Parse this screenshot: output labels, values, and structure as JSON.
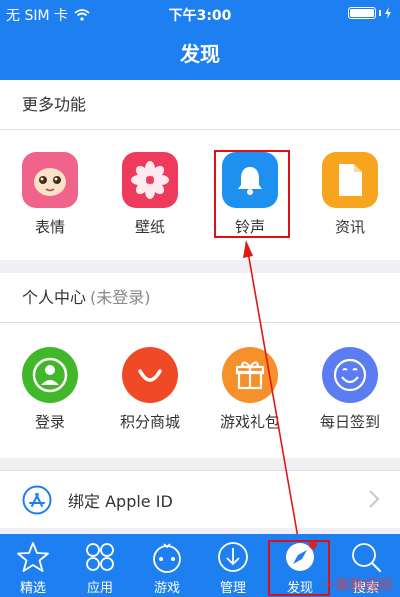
{
  "status_bar": {
    "carrier": "无 SIM 卡",
    "time": "下午3:00"
  },
  "nav": {
    "title": "发现"
  },
  "more_features": {
    "title": "更多功能",
    "items": [
      {
        "label": "表情",
        "icon": "emoji-face-icon",
        "color": "#f0648c"
      },
      {
        "label": "壁纸",
        "icon": "flower-icon",
        "color": "#ee3a5d"
      },
      {
        "label": "铃声",
        "icon": "bell-icon",
        "color": "#1e90f0"
      },
      {
        "label": "资讯",
        "icon": "document-icon",
        "color": "#f7a51e"
      }
    ]
  },
  "personal_center": {
    "title": "个人中心",
    "subtitle": "(未登录)",
    "items": [
      {
        "label": "登录",
        "icon": "user-icon",
        "color": "#42b72a"
      },
      {
        "label": "积分商城",
        "icon": "smile-arc-icon",
        "color": "#ef4a25"
      },
      {
        "label": "游戏礼包",
        "icon": "gift-icon",
        "color": "#f5902a"
      },
      {
        "label": "每日签到",
        "icon": "smiley-icon",
        "color": "#5b7cf2"
      }
    ]
  },
  "apple_row": {
    "label": "绑定 Apple ID"
  },
  "tabs": [
    {
      "label": "精选",
      "icon": "star-icon"
    },
    {
      "label": "应用",
      "icon": "apps-grid-icon"
    },
    {
      "label": "游戏",
      "icon": "gamepad-icon"
    },
    {
      "label": "管理",
      "icon": "download-icon"
    },
    {
      "label": "发现",
      "icon": "compass-icon"
    },
    {
      "label": "搜索",
      "icon": "search-icon"
    }
  ],
  "watermark": "一聚教程网"
}
